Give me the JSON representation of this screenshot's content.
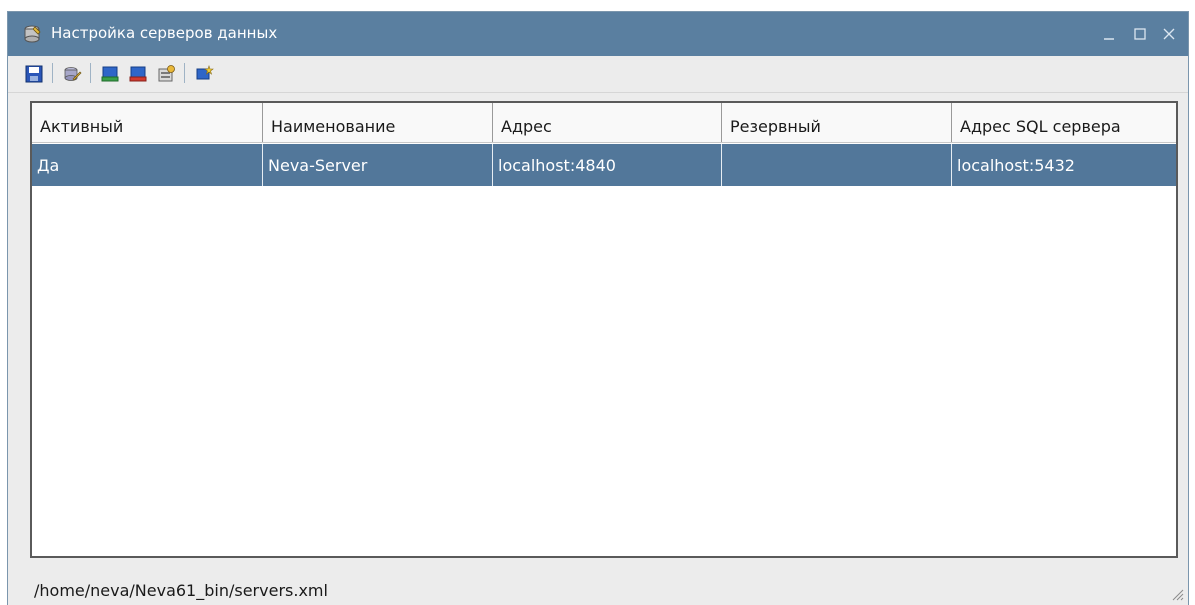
{
  "window": {
    "title": "Настройка серверов данных",
    "controls": {
      "minimize": "_",
      "maximize": "□",
      "close": "✕"
    }
  },
  "toolbar": {
    "buttons": [
      {
        "icon": "save-icon"
      },
      {
        "icon": "edit-icon"
      },
      {
        "icon": "add-server-icon"
      },
      {
        "icon": "remove-server-icon"
      },
      {
        "icon": "server-properties-icon"
      },
      {
        "icon": "new-server-icon"
      }
    ]
  },
  "table": {
    "columns": [
      "Активный",
      "Наименование",
      "Адрес",
      "Резервный",
      "Адрес SQL сервера"
    ],
    "rows": [
      {
        "active": "Да",
        "name": "Neva-Server",
        "address": "localhost:4840",
        "reserve": "",
        "sql_address": "localhost:5432"
      }
    ]
  },
  "status": {
    "path": "/home/neva/Neva61_bin/servers.xml"
  },
  "colors": {
    "titlebar": "#5a7fa0",
    "selected_row": "#52779a",
    "window_bg": "#ececec"
  }
}
